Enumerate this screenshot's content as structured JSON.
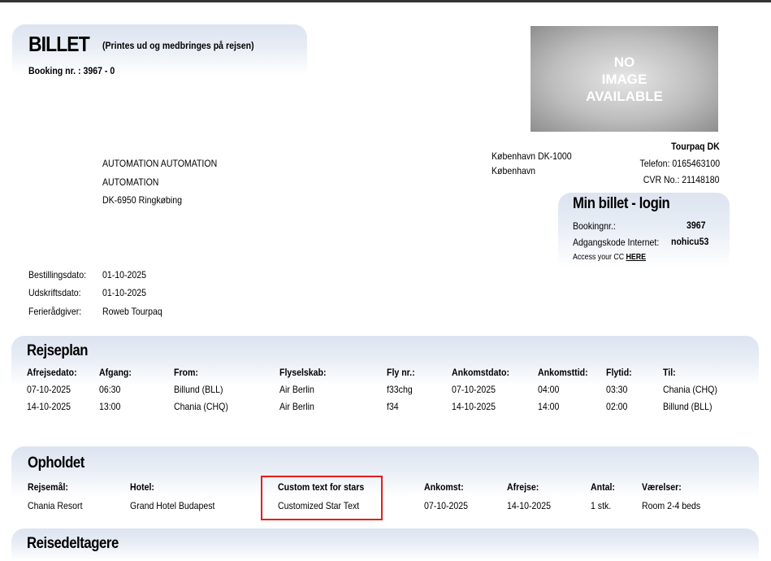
{
  "ticket": {
    "title": "BILLET",
    "subtitle": "(Printes ud og medbringes på rejsen)",
    "booking_line": "Booking nr. : 3967 - 0"
  },
  "image_placeholder": "NO\nIMAGE\nAVAILABLE",
  "customer": {
    "line1": "AUTOMATION AUTOMATION",
    "line2": "AUTOMATION",
    "line3": "DK-6950 Ringkøbing"
  },
  "agency": {
    "address1": "København DK-1000",
    "address2": "København",
    "name": "Tourpaq DK",
    "phone": "Telefon: 0165463100",
    "cvr": "CVR No.: 21148180"
  },
  "login": {
    "title": "Min billet - login",
    "booking_label": "Bookingnr.:",
    "booking_value": "3967",
    "code_label": "Adgangskode Internet:",
    "code_value": "nohicu53",
    "access_text": "Access your CC",
    "access_link": "HERE"
  },
  "meta": [
    {
      "label": "Bestillingsdato:",
      "value": "01-10-2025"
    },
    {
      "label": "Udskriftsdato:",
      "value": "01-10-2025"
    },
    {
      "label": "Ferierådgiver:",
      "value": "Roweb Tourpaq"
    }
  ],
  "rejseplan": {
    "title": "Rejseplan",
    "columns": [
      "Afrejsedato:",
      "Afgang:",
      "From:",
      "Flyselskab:",
      "Fly nr.:",
      "Ankomstdato:",
      "Ankomsttid:",
      "Flytid:",
      "Til:"
    ],
    "rows": [
      [
        "07-10-2025",
        "06:30",
        "Billund (BLL)",
        "Air Berlin",
        "f33chg",
        "07-10-2025",
        "04:00",
        "03:30",
        "Chania (CHQ)"
      ],
      [
        "14-10-2025",
        "13:00",
        "Chania (CHQ)",
        "Air Berlin",
        "f34",
        "14-10-2025",
        "14:00",
        "02:00",
        "Billund (BLL)"
      ]
    ]
  },
  "opholdet": {
    "title": "Opholdet",
    "columns": [
      "Rejsemål:",
      "Hotel:",
      "Custom text for stars",
      "Ankomst:",
      "Afrejse:",
      "Antal:",
      "Værelser:"
    ],
    "row": [
      "Chania Resort",
      "Grand Hotel Budapest",
      "Customized Star Text",
      "07-10-2025",
      "14-10-2025",
      "1 stk.",
      "Room 2-4 beds"
    ]
  },
  "reisedeltagere": {
    "title": "Reisedeltagere"
  },
  "colors": {
    "section_gradient": "#dde4f0",
    "highlight_border": "#e41e1e",
    "top_bar": "#333333"
  }
}
